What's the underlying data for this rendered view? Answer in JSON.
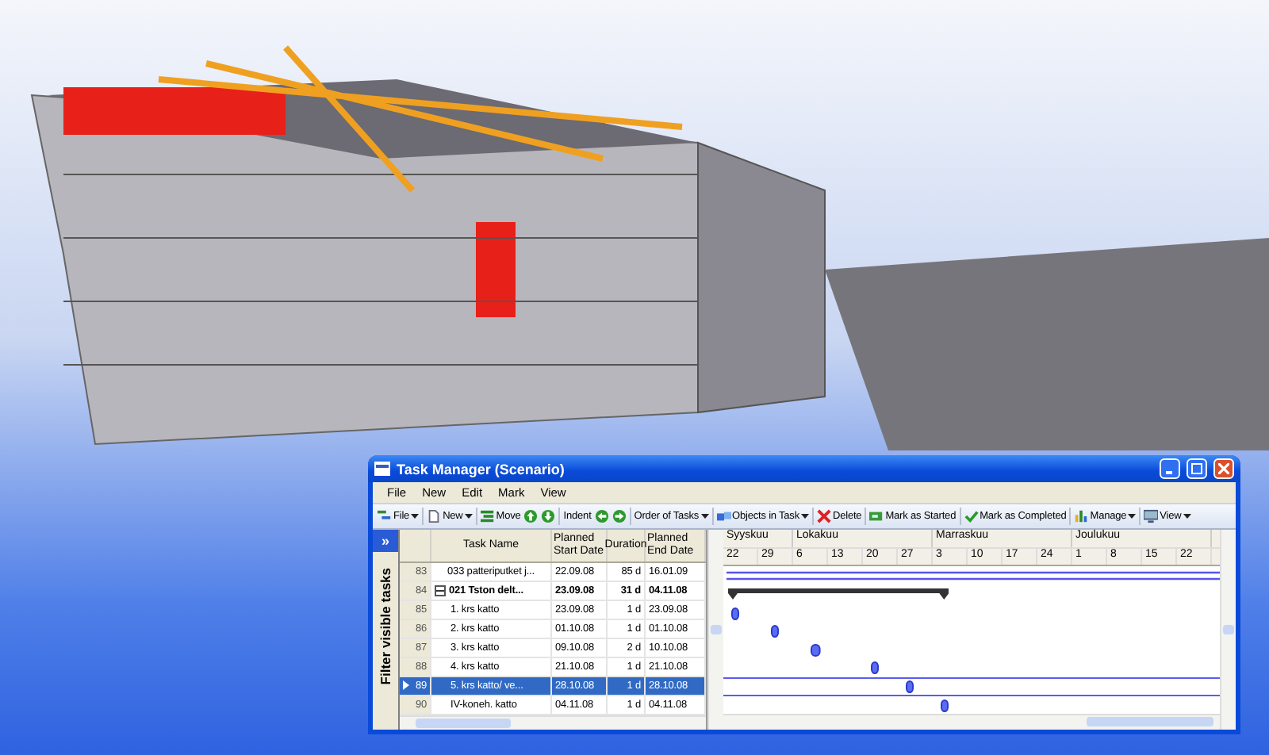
{
  "window": {
    "title": "Task Manager (Scenario)"
  },
  "menu": [
    "File",
    "New",
    "Edit",
    "Mark",
    "View"
  ],
  "toolbar": [
    {
      "label": "File",
      "dropdown": true
    },
    {
      "label": "New",
      "dropdown": true
    },
    {
      "label": "Move",
      "dropdown": false
    },
    {
      "dropdown": false
    },
    {
      "dropdown": false
    },
    {
      "label": "Indent",
      "dropdown": false
    },
    {
      "dropdown": false
    },
    {
      "dropdown": false
    },
    {
      "label": "Order of Tasks",
      "dropdown": true
    },
    {
      "label": "Objects in Task",
      "dropdown": true
    },
    {
      "label": "Delete",
      "dropdown": false
    },
    {
      "label": "Mark as Started",
      "dropdown": false
    },
    {
      "label": "Mark as Completed",
      "dropdown": false
    },
    {
      "label": "Manage",
      "dropdown": true
    },
    {
      "label": "View",
      "dropdown": true
    }
  ],
  "sidebar": {
    "toggle": "»",
    "label": "Filter visible tasks"
  },
  "table": {
    "columns": [
      "",
      "Task Name",
      "Planned Start Date",
      "Duration",
      "Planned End Date"
    ],
    "rows": [
      {
        "kind": "summary",
        "num": "83",
        "name": "033 patteriputket j...",
        "start": "22.09.08",
        "duration": "85 d",
        "end": "16.01.09",
        "selected": false,
        "bold": false
      },
      {
        "kind": "summary",
        "num": "84",
        "name": "021 Tston delt...",
        "start": "23.09.08",
        "duration": "31 d",
        "end": "04.11.08",
        "selected": false,
        "bold": true,
        "expanded": true,
        "children": [
          {
            "kind": "task",
            "num": "85",
            "name": "1. krs katto",
            "start": "23.09.08",
            "duration": "1 d",
            "end": "23.09.08",
            "selected": false
          },
          {
            "kind": "task",
            "num": "86",
            "name": "2. krs katto",
            "start": "01.10.08",
            "duration": "1 d",
            "end": "01.10.08",
            "selected": false
          },
          {
            "kind": "task",
            "num": "87",
            "name": "3. krs katto",
            "start": "09.10.08",
            "duration": "2 d",
            "end": "10.10.08",
            "selected": false
          },
          {
            "kind": "task",
            "num": "88",
            "name": "4. krs katto",
            "start": "21.10.08",
            "duration": "1 d",
            "end": "21.10.08",
            "selected": false
          },
          {
            "kind": "task",
            "num": "89",
            "name": "5. krs katto/ ve...",
            "start": "28.10.08",
            "duration": "1 d",
            "end": "28.10.08",
            "selected": true
          },
          {
            "kind": "task",
            "num": "90",
            "name": "IV-koneh. katto",
            "start": "04.11.08",
            "duration": "1 d",
            "end": "04.11.08",
            "selected": false
          }
        ]
      }
    ]
  },
  "timeline": {
    "months": [
      {
        "label": "Syyskuu",
        "weeks": [
          "22",
          "29"
        ]
      },
      {
        "label": "Lokakuu",
        "weeks": [
          "6",
          "13",
          "20",
          "27"
        ]
      },
      {
        "label": "Marraskuu",
        "weeks": [
          "3",
          "10",
          "17",
          "24"
        ]
      },
      {
        "label": "Joulukuu",
        "weeks": [
          "1",
          "8",
          "15",
          "22"
        ]
      }
    ]
  }
}
